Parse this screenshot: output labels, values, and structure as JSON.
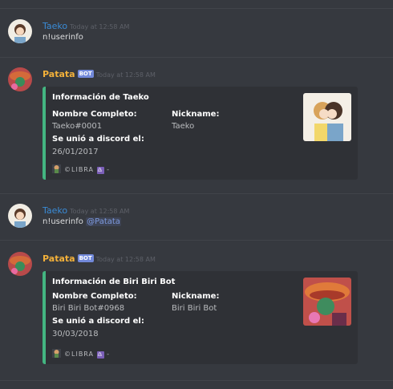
{
  "messages": [
    {
      "author": "Taeko",
      "timestamp": "Today at 12:58 AM",
      "text": "n!userinfo"
    },
    {
      "author": "Patata",
      "badge": "BOT",
      "timestamp": "Today at 12:58 AM",
      "embed": {
        "title": "Información de Taeko",
        "fields": [
          {
            "name": "Nombre Completo:",
            "value": "Taeko#0001"
          },
          {
            "name": "Nickname:",
            "value": "Taeko"
          },
          {
            "name": "Se unió a discord el:",
            "value": "26/01/2017"
          }
        ],
        "footer": "©LIBRA",
        "footer_suffix": "-",
        "libra_symbol": "♎",
        "color": "#43b581"
      }
    },
    {
      "author": "Taeko",
      "timestamp": "Today at 12:58 AM",
      "text": "n!userinfo",
      "mention": "@Patata"
    },
    {
      "author": "Patata",
      "badge": "BOT",
      "timestamp": "Today at 12:58 AM",
      "embed": {
        "title": "Información de Biri Biri Bot",
        "fields": [
          {
            "name": "Nombre Completo:",
            "value": "Biri Biri Bot#0968"
          },
          {
            "name": "Nickname:",
            "value": "Biri Biri Bot"
          },
          {
            "name": "Se unió a discord el:",
            "value": "30/03/2018"
          }
        ],
        "footer": "©LIBRA",
        "footer_suffix": "-",
        "libra_symbol": "♎",
        "color": "#43b581"
      }
    }
  ],
  "colors": {
    "background": "#36393f",
    "embed_bg": "#2f3136",
    "user_name": "#3a8bd6",
    "bot_name": "#f3b13a",
    "bot_badge": "#7289da"
  }
}
